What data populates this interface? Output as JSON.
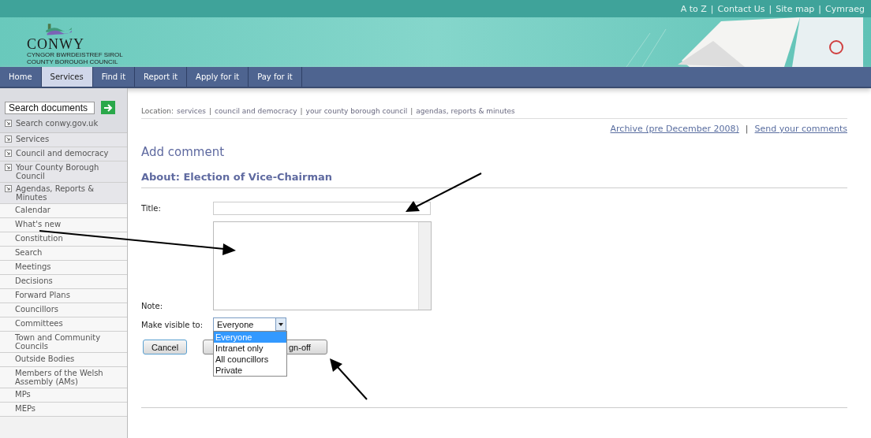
{
  "top_links": [
    "A to Z",
    "Contact Us",
    "Site map",
    "Cymraeg"
  ],
  "top_links_separator": "|",
  "logo": {
    "name": "CONWY",
    "subtitle_lines": [
      "CYNGOR BWRDEISTREF SIROL",
      "COUNTY BOROUGH COUNCIL"
    ]
  },
  "nav": [
    {
      "label": "Home",
      "selected": false
    },
    {
      "label": "Services",
      "selected": true
    },
    {
      "label": "Find it",
      "selected": false
    },
    {
      "label": "Report it",
      "selected": false
    },
    {
      "label": "Apply for it",
      "selected": false
    },
    {
      "label": "Pay for it",
      "selected": false
    }
  ],
  "sidebar": {
    "search": {
      "value": "Search documents"
    },
    "site_search_link": "Search conwy.gov.uk",
    "sections": [
      {
        "label": "Services",
        "kind": "section"
      },
      {
        "label": "Council and democracy",
        "kind": "section"
      },
      {
        "label": "Your County Borough Council",
        "kind": "section"
      },
      {
        "label": "Agendas, Reports & Minutes",
        "kind": "section"
      },
      {
        "label": "Calendar",
        "kind": "sub"
      },
      {
        "label": "What's new",
        "kind": "sub"
      },
      {
        "label": "Constitution",
        "kind": "sub"
      },
      {
        "label": "Search",
        "kind": "sub"
      },
      {
        "label": "Meetings",
        "kind": "sub"
      },
      {
        "label": "Decisions",
        "kind": "sub"
      },
      {
        "label": "Forward Plans",
        "kind": "sub"
      },
      {
        "label": "Councillors",
        "kind": "sub"
      },
      {
        "label": "Committees",
        "kind": "sub"
      },
      {
        "label": "Town and Community Councils",
        "kind": "sub"
      },
      {
        "label": "Outside Bodies",
        "kind": "sub"
      },
      {
        "label": "Members of the Welsh Assembly (AMs)",
        "kind": "sub"
      },
      {
        "label": "MPs",
        "kind": "sub"
      },
      {
        "label": "MEPs",
        "kind": "sub"
      }
    ]
  },
  "breadcrumb": {
    "prefix": "Location:",
    "separator": "|",
    "items": [
      "services",
      "council and democracy",
      "your county borough council",
      "agendas, reports & minutes"
    ]
  },
  "page_links": [
    "Archive (pre December 2008)",
    "Send your comments"
  ],
  "page_links_separator": "|",
  "heading": "Add comment",
  "subheading": "About: Election of Vice-Chairman",
  "form": {
    "title_label": "Title:",
    "note_label": "Note:",
    "visibility_label": "Make visible to:",
    "visibility_value": "Everyone",
    "options": [
      {
        "label": "Everyone",
        "selected": true
      },
      {
        "label": "Intranet only",
        "selected": false
      },
      {
        "label": "All councillors",
        "selected": false
      },
      {
        "label": "Private",
        "selected": false
      }
    ],
    "buttons": [
      "Cancel",
      "gn-off"
    ]
  }
}
